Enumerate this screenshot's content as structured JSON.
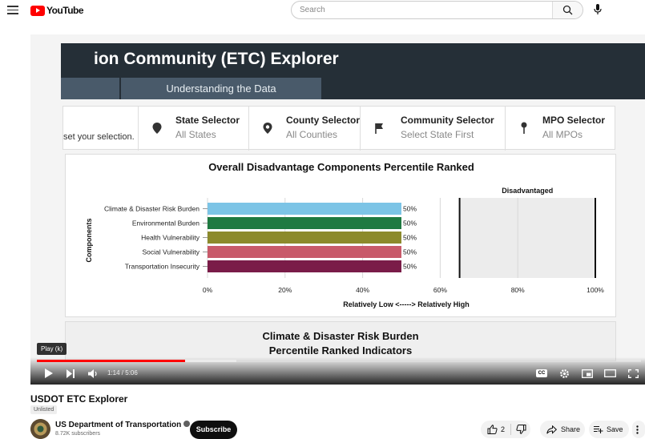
{
  "header": {
    "logo_text": "YouTube",
    "search_placeholder": "Search"
  },
  "video_frame": {
    "app_title": "ion Community (ETC) Explorer",
    "tab_understanding": "Understanding the Data",
    "reset_text": "set your selection.",
    "selectors": [
      {
        "title": "State Selector",
        "value": "All States",
        "icon": "map-pin-icon"
      },
      {
        "title": "County Selector",
        "value": "All Counties",
        "icon": "map-pin-icon"
      },
      {
        "title": "Community Selector",
        "value": "Select State First",
        "icon": "flag-icon"
      },
      {
        "title": "MPO Selector",
        "value": "All MPOs",
        "icon": "pushpin-icon"
      }
    ],
    "panel2_line1": "Climate & Disaster Risk Burden",
    "panel2_line2": "Percentile Ranked Indicators"
  },
  "chart_data": {
    "type": "bar",
    "orientation": "horizontal",
    "title": "Overall Disadvantage Components Percentile Ranked",
    "ylabel": "Components",
    "xlabel": "Relatively Low <-----> Relatively High",
    "categories": [
      "Climate & Disaster Risk Burden",
      "Environmental Burden",
      "Health Vulnerability",
      "Social Vulnerability",
      "Transportation Insecurity"
    ],
    "values": [
      50,
      50,
      50,
      50,
      50
    ],
    "data_labels": [
      "50%",
      "50%",
      "50%",
      "50%",
      "50%"
    ],
    "colors": [
      "#7cc4e6",
      "#1f7a41",
      "#8c8a2c",
      "#c85a6a",
      "#7a1c48"
    ],
    "xticks": [
      "0%",
      "20%",
      "40%",
      "60%",
      "80%",
      "100%"
    ],
    "xlim": [
      0,
      100
    ],
    "shaded_region_label": "Disadvantaged",
    "shaded_region": [
      65,
      100
    ],
    "grid": true
  },
  "player": {
    "tooltip": "Play (k)",
    "timecode": "1:14 / 5:06",
    "progress_fraction": 0.245,
    "buffered_fraction": 0.33,
    "cc_label": "CC"
  },
  "below": {
    "video_title": "USDOT ETC Explorer",
    "unlisted_label": "Unlisted",
    "channel_name": "US Department of Transportation",
    "subscribers": "8.72K subscribers",
    "subscribe_label": "Subscribe",
    "like_count": "2",
    "share_label": "Share",
    "save_label": "Save"
  }
}
